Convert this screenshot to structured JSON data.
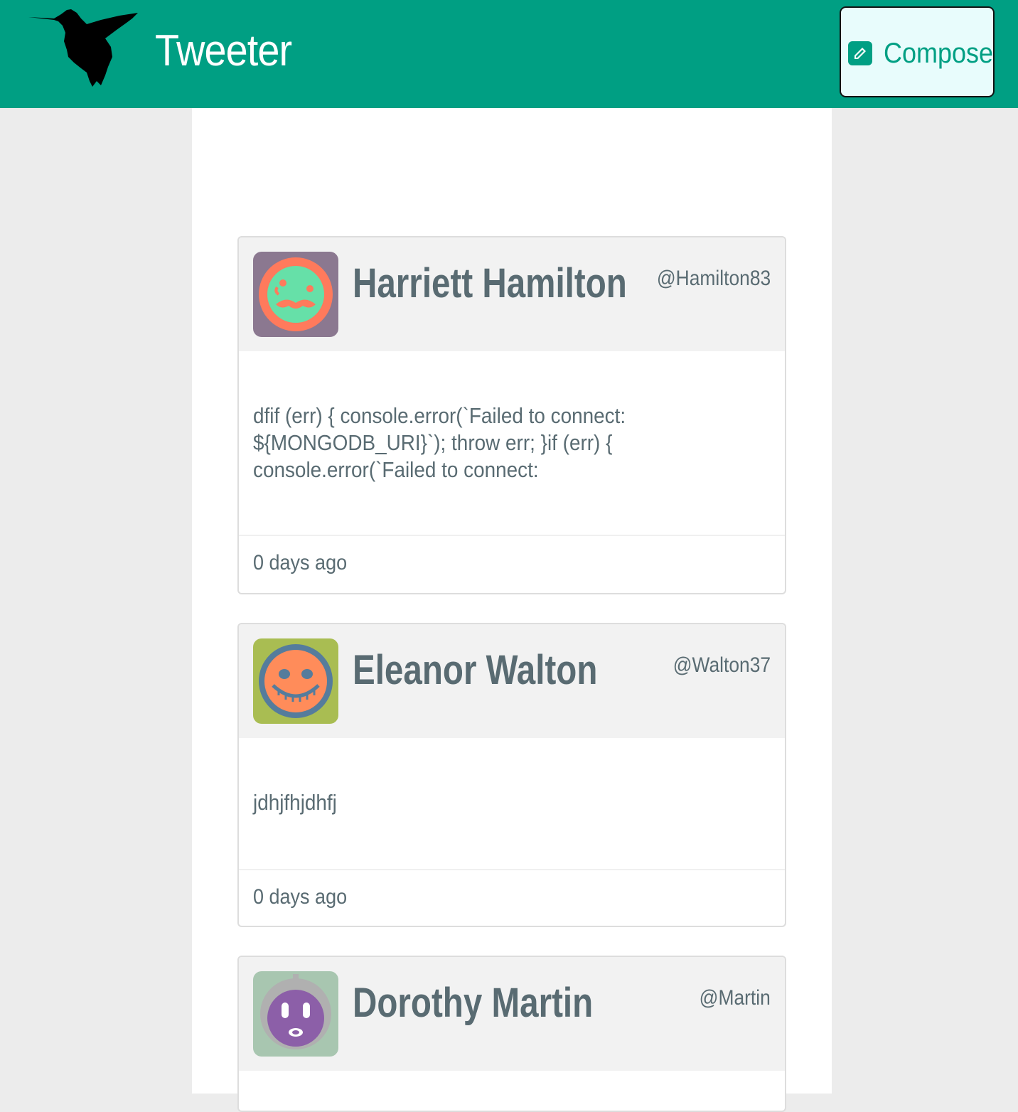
{
  "header": {
    "app_title": "Tweeter",
    "logo_icon": "hummingbird-logo",
    "compose_label": "Compose",
    "compose_icon": "edit-pencil-icon",
    "brand_color": "#009f83"
  },
  "tweets": [
    {
      "name": "Harriett Hamilton",
      "handle": "@Hamilton83",
      "text": "dfif (err) { console.error(`Failed to connect: ${MONGODB_URI}`); throw err; }if (err) { console.error(`Failed to connect:",
      "time": "0 days ago",
      "avatar_icon": "mustache-face-avatar"
    },
    {
      "name": "Eleanor Walton",
      "handle": "@Walton37",
      "text": "jdhjfhjdhfj",
      "time": "0 days ago",
      "avatar_icon": "pumpkin-face-avatar"
    },
    {
      "name": "Dorothy Martin",
      "handle": "@Martin",
      "text": "",
      "time": "",
      "avatar_icon": "robot-face-avatar"
    }
  ]
}
